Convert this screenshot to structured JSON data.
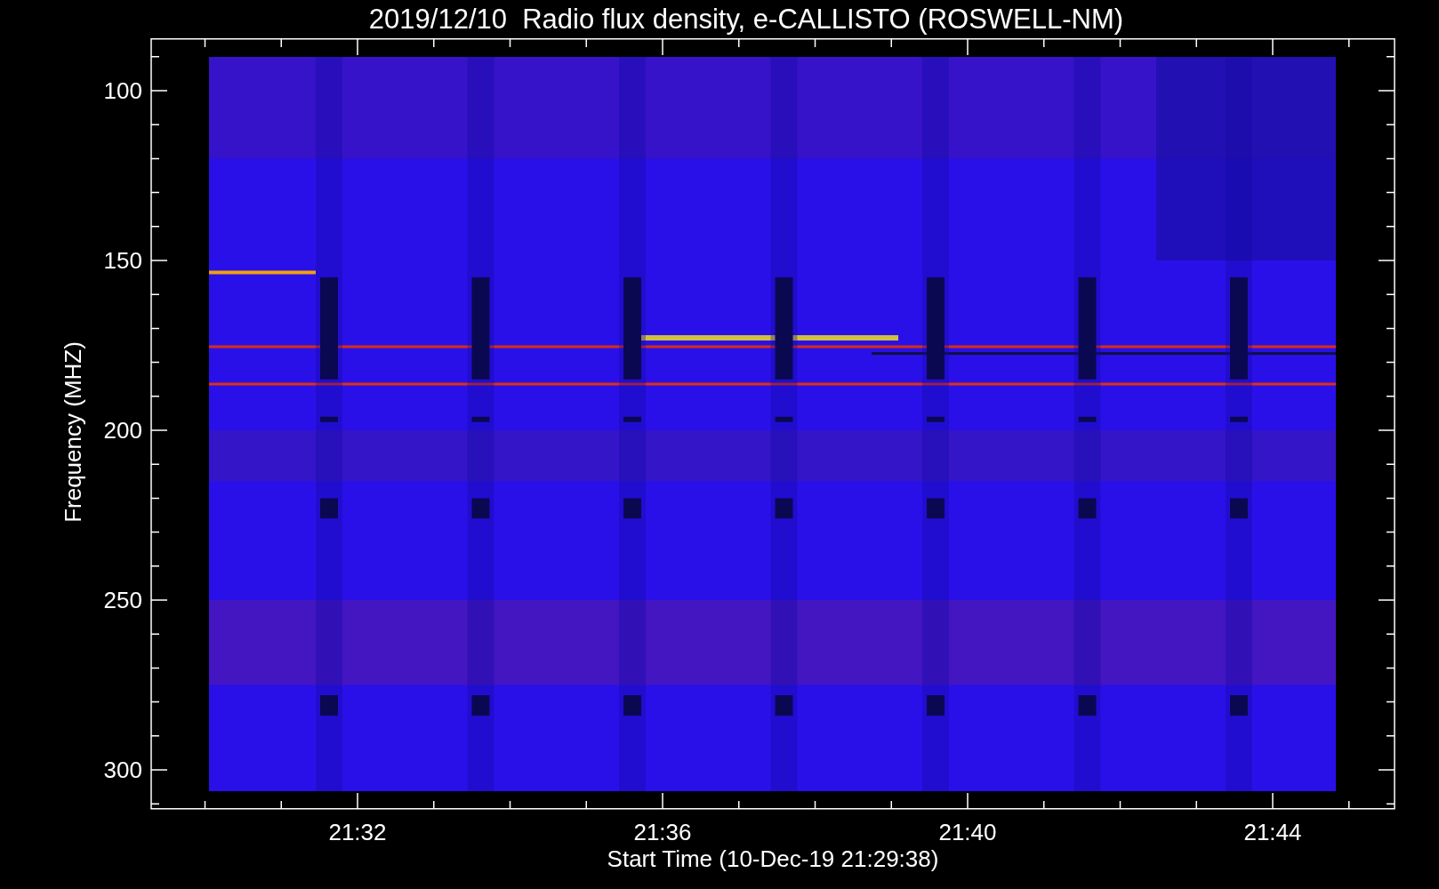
{
  "plot": {
    "title": "2019/12/10  Radio flux density, e-CALLISTO (ROSWELL-NM)",
    "ylabel": "Frequency (MHZ)",
    "xlabel": "Start Time (10-Dec-19 21:29:38)",
    "yticks": [
      "100",
      "150",
      "200",
      "250",
      "300"
    ],
    "xticks": [
      "21:32",
      "21:36",
      "21:40",
      "21:44"
    ]
  }
}
